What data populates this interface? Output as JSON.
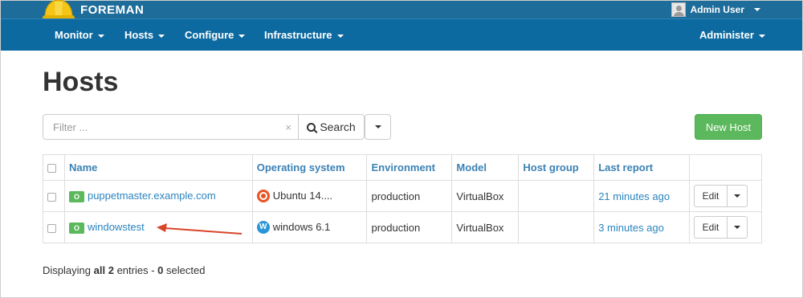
{
  "header": {
    "brand": "FOREMAN",
    "user_label": "Admin User"
  },
  "nav": {
    "items": [
      {
        "label": "Monitor"
      },
      {
        "label": "Hosts"
      },
      {
        "label": "Configure"
      },
      {
        "label": "Infrastructure"
      }
    ],
    "admin_label": "Administer"
  },
  "page": {
    "title": "Hosts"
  },
  "search": {
    "placeholder": "Filter ...",
    "clear_glyph": "×",
    "button_label": "Search"
  },
  "actions": {
    "new_host_label": "New Host"
  },
  "table": {
    "columns": [
      "Name",
      "Operating system",
      "Environment",
      "Model",
      "Host group",
      "Last report"
    ],
    "rows": [
      {
        "status": "O",
        "name": "puppetmaster.example.com",
        "os": "Ubuntu 14....",
        "os_icon": "ubuntu-icon",
        "environment": "production",
        "model": "VirtualBox",
        "host_group": "",
        "last_report": "21 minutes ago",
        "edit_label": "Edit"
      },
      {
        "status": "O",
        "name": "windowstest",
        "os": "windows 6.1",
        "os_icon": "windows-icon",
        "os_icon_letter": "W",
        "environment": "production",
        "model": "VirtualBox",
        "host_group": "",
        "last_report": "3 minutes ago",
        "edit_label": "Edit"
      }
    ]
  },
  "footer": {
    "prefix": "Displaying",
    "all_word": "all",
    "count": "2",
    "middle": "entries -",
    "selected_count": "0",
    "suffix": "selected"
  },
  "colors": {
    "topbar": "#1d6c9a",
    "navbar": "#0d6aa0",
    "link": "#2a84bd",
    "success": "#5cb85c",
    "annotation_arrow": "#d9452b"
  }
}
